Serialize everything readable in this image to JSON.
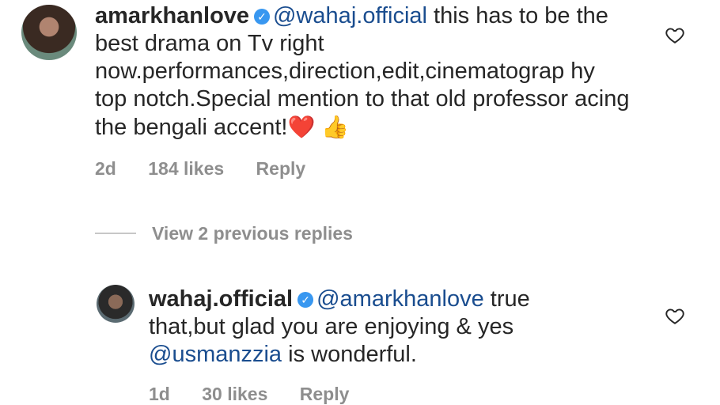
{
  "comments": [
    {
      "username": "amarkhanlove",
      "mention": "@wahaj.official",
      "text": " this has to be the best drama on Tv right now.performances,direction,edit,cinematograp hy top notch.Special mention to that old professor acing the bengali accent!",
      "emoji_heart": "❤️",
      "emoji_thumb": "👍",
      "time": "2d",
      "likes": "184 likes",
      "reply_label": "Reply"
    },
    {
      "username": "wahaj.official",
      "mention": "@amarkhanlove",
      "text_a": " true that,but glad you are enjoying & yes ",
      "mention2": "@usmanzzia",
      "text_b": "  is wonderful.",
      "time": "1d",
      "likes": "30 likes",
      "reply_label": "Reply"
    }
  ],
  "view_replies": "View 2 previous replies",
  "verified_icon": "verified-badge-icon",
  "like_icon": "heart-outline-icon",
  "colors": {
    "mention": "#1a4d8f",
    "meta": "#8e8e8e",
    "badge": "#3897f0"
  }
}
